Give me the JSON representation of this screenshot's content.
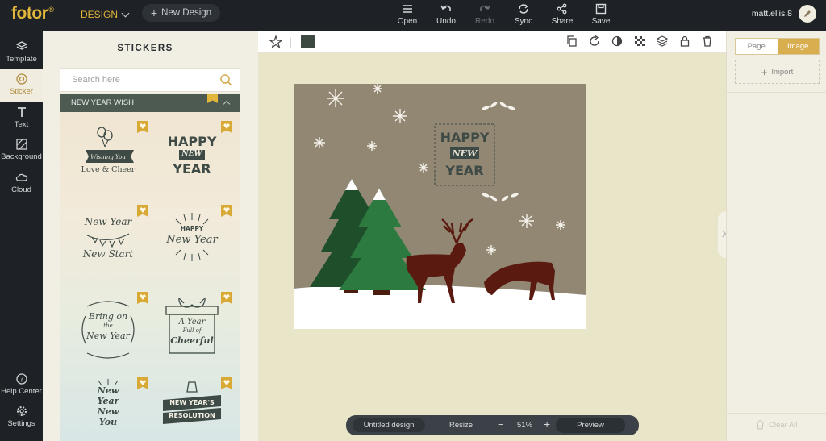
{
  "app": {
    "logo": "fotor",
    "logo_mark": "®",
    "menu": "DESIGN",
    "new_design": "New Design",
    "user": "matt.ellis.8"
  },
  "toolbar": {
    "open": "Open",
    "undo": "Undo",
    "redo": "Redo",
    "sync": "Sync",
    "share": "Share",
    "save": "Save"
  },
  "nav": {
    "template": "Template",
    "sticker": "Sticker",
    "text": "Text",
    "background": "Background",
    "cloud": "Cloud",
    "help": "Help Center",
    "settings": "Settings"
  },
  "panel": {
    "title": "STICKERS",
    "search_placeholder": "Search here",
    "category": "NEW YEAR WISH",
    "stickers": [
      {
        "lines": [
          "Wishing You",
          "Love & Cheer"
        ]
      },
      {
        "lines": [
          "HAPPY",
          "NEW",
          "YEAR"
        ]
      },
      {
        "lines": [
          "New Year",
          "New Start"
        ]
      },
      {
        "lines": [
          "HAPPY",
          "New Year"
        ]
      },
      {
        "lines": [
          "Bring on",
          "the",
          "New Year"
        ]
      },
      {
        "lines": [
          "A Year",
          "Full of",
          "Cheerful"
        ]
      },
      {
        "lines": [
          "New",
          "Year",
          "New",
          "You"
        ]
      },
      {
        "lines": [
          "NEW YEAR'S",
          "RESOLUTION"
        ]
      }
    ]
  },
  "canvas": {
    "sticker_lines": [
      "HAPPY",
      "NEW",
      "YEAR"
    ],
    "accent": "#3d4a42",
    "background": "#928773"
  },
  "right": {
    "tab_page": "Page",
    "tab_image": "Image",
    "import": "Import",
    "clear_all": "Clear All"
  },
  "bottom": {
    "name": "Untitled design",
    "resize": "Resize",
    "minus": "−",
    "zoom": "51%",
    "plus": "+",
    "preview": "Preview"
  }
}
